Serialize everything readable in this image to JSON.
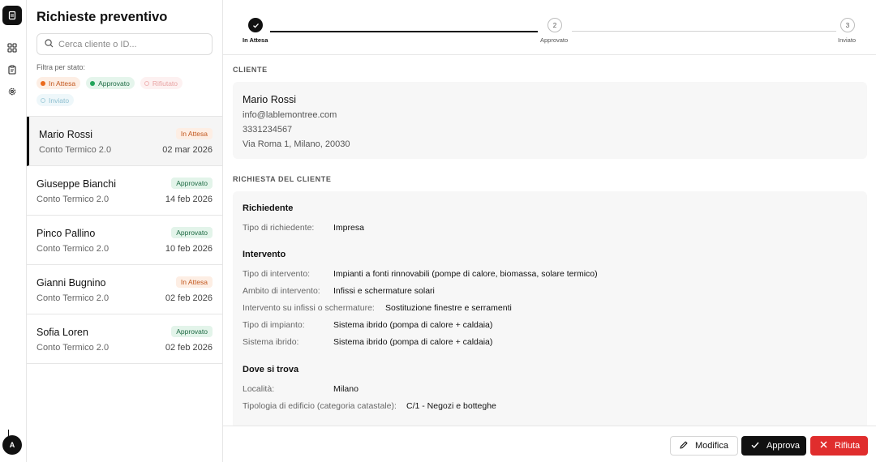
{
  "rail": {
    "logo_icon": "document-icon",
    "icons": [
      "dashboard-icon",
      "clipboard-icon",
      "gear-icon"
    ],
    "avatar_initial": "A"
  },
  "list": {
    "title": "Richieste preventivo",
    "search_placeholder": "Cerca cliente o ID...",
    "filter_label": "Filtra per stato:",
    "filters": [
      {
        "label": "In Attesa",
        "key": "attesa"
      },
      {
        "label": "Approvato",
        "key": "approvato"
      },
      {
        "label": "Rifiutato",
        "key": "rifiutato"
      },
      {
        "label": "Inviato",
        "key": "inviato"
      }
    ],
    "items": [
      {
        "name": "Mario Rossi",
        "product": "Conto Termico 2.0",
        "date": "02 mar 2026",
        "status": "In Attesa",
        "status_key": "attesa",
        "selected": true
      },
      {
        "name": "Giuseppe Bianchi",
        "product": "Conto Termico 2.0",
        "date": "14 feb 2026",
        "status": "Approvato",
        "status_key": "approvato",
        "selected": false
      },
      {
        "name": "Pinco Pallino",
        "product": "Conto Termico 2.0",
        "date": "10 feb 2026",
        "status": "Approvato",
        "status_key": "approvato",
        "selected": false
      },
      {
        "name": "Gianni Bugnino",
        "product": "Conto Termico 2.0",
        "date": "02 feb 2026",
        "status": "In Attesa",
        "status_key": "attesa",
        "selected": false
      },
      {
        "name": "Sofia Loren",
        "product": "Conto Termico 2.0",
        "date": "02 feb 2026",
        "status": "Approvato",
        "status_key": "approvato",
        "selected": false
      }
    ]
  },
  "stepper": {
    "steps": [
      {
        "label": "In Attesa",
        "marker": "check",
        "state": "done"
      },
      {
        "label": "Approvato",
        "marker": "2",
        "state": "todo"
      },
      {
        "label": "Inviato",
        "marker": "3",
        "state": "todo"
      }
    ]
  },
  "client": {
    "section_title": "CLIENTE",
    "name": "Mario Rossi",
    "email": "info@lablemontree.com",
    "phone": "3331234567",
    "address": "Via Roma 1, Milano, 20030"
  },
  "request": {
    "section_title": "RICHIESTA DEL CLIENTE",
    "groups": [
      {
        "title": "Richiedente",
        "rows": [
          {
            "label": "Tipo di richiedente:",
            "value": "Impresa"
          }
        ]
      },
      {
        "title": "Intervento",
        "rows": [
          {
            "label": "Tipo di intervento:",
            "value": "Impianti a fonti rinnovabili (pompe di calore, biomassa, solare termico)"
          },
          {
            "label": "Ambito di intervento:",
            "value": "Infissi e schermature solari"
          },
          {
            "label": "Intervento su infissi o schermature:",
            "value": "Sostituzione finestre e serramenti"
          },
          {
            "label": "Tipo di impianto:",
            "value": "Sistema ibrido (pompa di calore + caldaia)"
          },
          {
            "label": "Sistema ibrido:",
            "value": "Sistema ibrido (pompa di calore + caldaia)"
          }
        ]
      },
      {
        "title": "Dove si trova",
        "rows": [
          {
            "label": "Località:",
            "value": "Milano"
          },
          {
            "label": "Tipologia di edificio (categoria catastale):",
            "value": "C/1 - Negozi e botteghe"
          }
        ]
      }
    ]
  },
  "actions": {
    "edit": "Modifica",
    "approve": "Approva",
    "reject": "Rifiuta"
  },
  "colors": {
    "accent": "#111111",
    "danger": "#e02d2d",
    "pending": "#ea6a1e",
    "approved": "#22a55b"
  }
}
